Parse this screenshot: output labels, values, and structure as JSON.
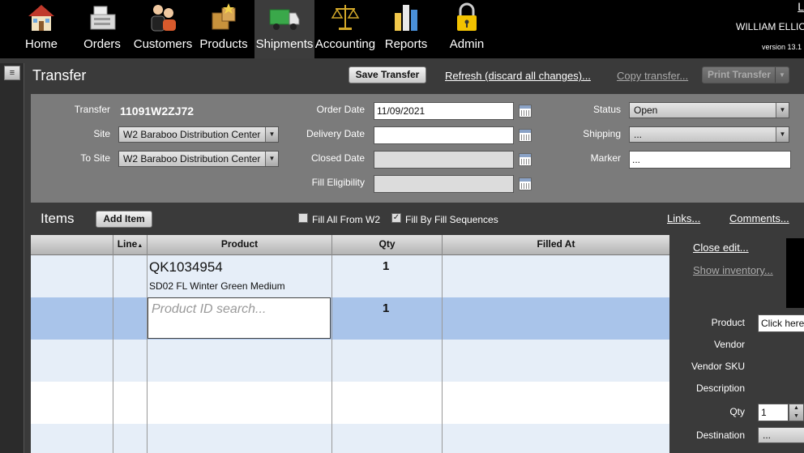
{
  "nav": [
    {
      "label": "Home",
      "icon": "house-icon"
    },
    {
      "label": "Orders",
      "icon": "cash-register-icon"
    },
    {
      "label": "Customers",
      "icon": "people-icon"
    },
    {
      "label": "Products",
      "icon": "boxes-icon"
    },
    {
      "label": "Shipments",
      "icon": "truck-icon",
      "active": true
    },
    {
      "label": "Accounting",
      "icon": "scales-icon"
    },
    {
      "label": "Reports",
      "icon": "bar-chart-icon"
    },
    {
      "label": "Admin",
      "icon": "padlock-icon"
    }
  ],
  "user": {
    "link": "L",
    "name": "WILLIAM ELLIO",
    "version": "version 13.1"
  },
  "page": {
    "title": "Transfer",
    "save_button": "Save Transfer",
    "refresh_link": "Refresh (discard all changes)...",
    "copy_link": "Copy transfer...",
    "print_button": "Print Transfer"
  },
  "form": {
    "transfer_label": "Transfer",
    "transfer_value": "11091W2ZJ72",
    "site_label": "Site",
    "site_value": "W2  Baraboo Distribution Center",
    "tosite_label": "To Site",
    "tosite_value": "W2  Baraboo Distribution Center",
    "order_date_label": "Order Date",
    "order_date_value": "11/09/2021",
    "delivery_date_label": "Delivery Date",
    "delivery_date_value": "",
    "closed_date_label": "Closed Date",
    "closed_date_value": "",
    "fill_eligibility_label": "Fill Eligibility",
    "fill_eligibility_value": "",
    "status_label": "Status",
    "status_value": "Open",
    "shipping_label": "Shipping",
    "shipping_value": "...",
    "marker_label": "Marker",
    "marker_value": "..."
  },
  "items": {
    "title": "Items",
    "add_button": "Add Item",
    "fill_all_label": "Fill All From W2",
    "fill_all_checked": false,
    "fill_seq_label": "Fill By Fill Sequences",
    "fill_seq_checked": true,
    "links_link": "Links...",
    "comments_link": "Comments...",
    "columns": [
      "",
      "Line",
      "Product",
      "Qty",
      "Filled At"
    ],
    "rows": [
      {
        "product_id": "QK1034954",
        "product_desc": "SD02 FL Winter Green Medium",
        "qty": "1"
      },
      {
        "product_id": "",
        "product_desc": "",
        "qty": "1",
        "search_placeholder": "Product ID search..."
      }
    ]
  },
  "side": {
    "close_edit": "Close edit...",
    "show_inventory": "Show inventory...",
    "product_label": "Product",
    "product_value": "Click here",
    "vendor_label": "Vendor",
    "vendor_sku_label": "Vendor SKU",
    "description_label": "Description",
    "qty_label": "Qty",
    "qty_value": "1",
    "destination_label": "Destination",
    "destination_value": "..."
  }
}
